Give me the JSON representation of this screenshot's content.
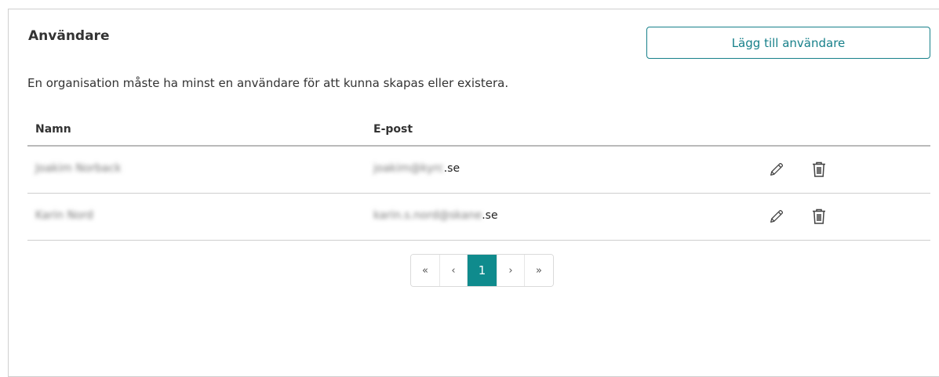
{
  "section": {
    "title": "Användare",
    "add_button": "Lägg till användare",
    "description": "En organisation måste ha minst en användare för att kunna skapas eller existera."
  },
  "table": {
    "columns": {
      "name": "Namn",
      "email": "E-post"
    },
    "rows": [
      {
        "name": "Joakim Norback",
        "email_hidden": "joakim@kyrc",
        "email_suffix": ".se"
      },
      {
        "name": "Karin Nord",
        "email_hidden": "karin.s.nord@skane",
        "email_suffix": ".se"
      }
    ]
  },
  "pagination": {
    "first": "«",
    "prev": "‹",
    "current": "1",
    "next": "›",
    "last": "»"
  },
  "icons": {
    "edit": "pencil-icon",
    "delete": "trash-icon"
  },
  "colors": {
    "accent": "#17808a",
    "active_page": "#0f8b8d"
  }
}
